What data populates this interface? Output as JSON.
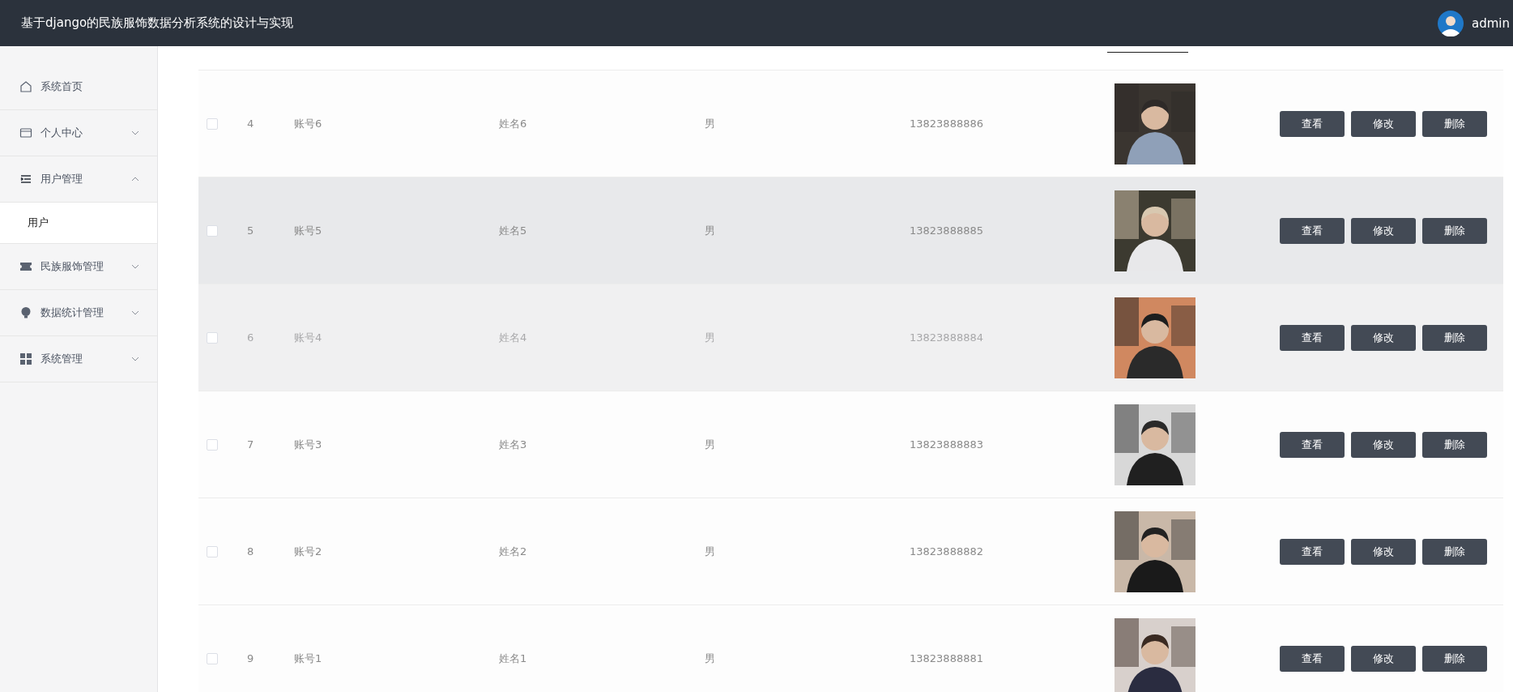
{
  "header": {
    "title": "基于django的民族服饰数据分析系统的设计与实现",
    "user": "admin"
  },
  "sidebar": {
    "items": [
      {
        "label": "系统首页"
      },
      {
        "label": "个人中心",
        "expanded": false
      },
      {
        "label": "用户管理",
        "expanded": true,
        "children": [
          {
            "label": "用户",
            "selected": true
          }
        ]
      },
      {
        "label": "民族服饰管理",
        "expanded": false
      },
      {
        "label": "数据统计管理",
        "expanded": false
      },
      {
        "label": "系统管理",
        "expanded": false
      }
    ]
  },
  "table": {
    "rows": [
      {
        "index": "4",
        "account": "账号6",
        "name": "姓名6",
        "sex": "男",
        "phone": "13823888886",
        "checked": false,
        "highlighted": false,
        "faded": false,
        "actions": [
          "查看",
          "修改",
          "删除"
        ]
      },
      {
        "index": "5",
        "account": "账号5",
        "name": "姓名5",
        "sex": "男",
        "phone": "13823888885",
        "checked": false,
        "highlighted": true,
        "faded": false,
        "actions": [
          "查看",
          "修改",
          "删除"
        ]
      },
      {
        "index": "6",
        "account": "账号4",
        "name": "姓名4",
        "sex": "男",
        "phone": "13823888884",
        "checked": false,
        "highlighted": false,
        "faded": true,
        "actions": [
          "查看",
          "修改",
          "删除"
        ]
      },
      {
        "index": "7",
        "account": "账号3",
        "name": "姓名3",
        "sex": "男",
        "phone": "13823888883",
        "checked": false,
        "highlighted": false,
        "faded": false,
        "actions": [
          "查看",
          "修改",
          "删除"
        ]
      },
      {
        "index": "8",
        "account": "账号2",
        "name": "姓名2",
        "sex": "男",
        "phone": "13823888882",
        "checked": false,
        "highlighted": false,
        "faded": false,
        "actions": [
          "查看",
          "修改",
          "删除"
        ]
      },
      {
        "index": "9",
        "account": "账号1",
        "name": "姓名1",
        "sex": "男",
        "phone": "13823888881",
        "checked": false,
        "highlighted": false,
        "faded": false,
        "actions": [
          "查看",
          "修改",
          "删除"
        ]
      }
    ]
  }
}
